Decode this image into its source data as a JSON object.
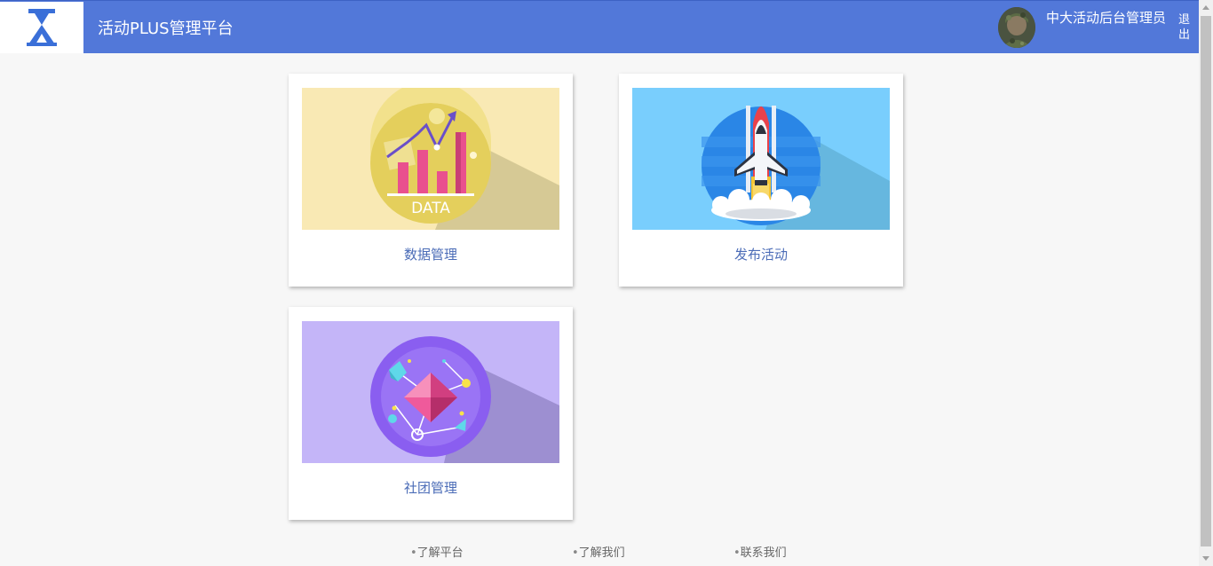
{
  "header": {
    "title": "活动PLUS管理平台",
    "user_name": "中大活动后台管理员",
    "logout": "退出",
    "bg_color": "#5278d9"
  },
  "cards": [
    {
      "label": "数据管理",
      "image_icon": "data-chart-icon",
      "image_text": "DATA",
      "bg": "#f9e9b4"
    },
    {
      "label": "发布活动",
      "image_icon": "rocket-icon",
      "bg": "#79cefd"
    },
    {
      "label": "社团管理",
      "image_icon": "gem-network-icon",
      "bg": "#c4b5f8"
    }
  ],
  "footer": {
    "links": [
      "了解平台",
      "了解我们",
      "联系我们"
    ],
    "bullet": "•"
  }
}
